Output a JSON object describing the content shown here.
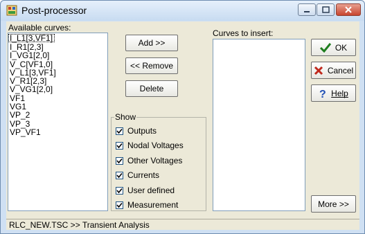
{
  "window": {
    "title": "Post-processor"
  },
  "available": {
    "label": "Available curves:",
    "items": [
      "I_L1[3,VF1]",
      "I_R1[2,3]",
      "I_VG1[2,0]",
      "V_C[VF1,0]",
      "V_L1[3,VF1]",
      "V_R1[2,3]",
      "V_VG1[2,0]",
      "VF1",
      "VG1",
      "VP_2",
      "VP_3",
      "VP_VF1"
    ]
  },
  "actions": {
    "add": "Add >>",
    "remove": "<< Remove",
    "delete": "Delete"
  },
  "show": {
    "label": "Show",
    "options": [
      {
        "label": "Outputs",
        "checked": true
      },
      {
        "label": "Nodal Voltages",
        "checked": true
      },
      {
        "label": "Other Voltages",
        "checked": true
      },
      {
        "label": "Currents",
        "checked": true
      },
      {
        "label": "User defined",
        "checked": true
      },
      {
        "label": "Measurement",
        "checked": true
      }
    ]
  },
  "insert": {
    "label": "Curves to insert:",
    "items": []
  },
  "dialog": {
    "ok": "OK",
    "cancel": "Cancel",
    "help": "Help",
    "more": "More >>"
  },
  "status": {
    "text": "RLC_NEW.TSC >> Transient Analysis"
  },
  "icons": {
    "ok": "check-icon",
    "cancel": "x-icon",
    "help": "question-icon"
  },
  "colors": {
    "accent": "#1e7d1e",
    "cancel": "#c0281c",
    "help": "#1f4fb5"
  }
}
